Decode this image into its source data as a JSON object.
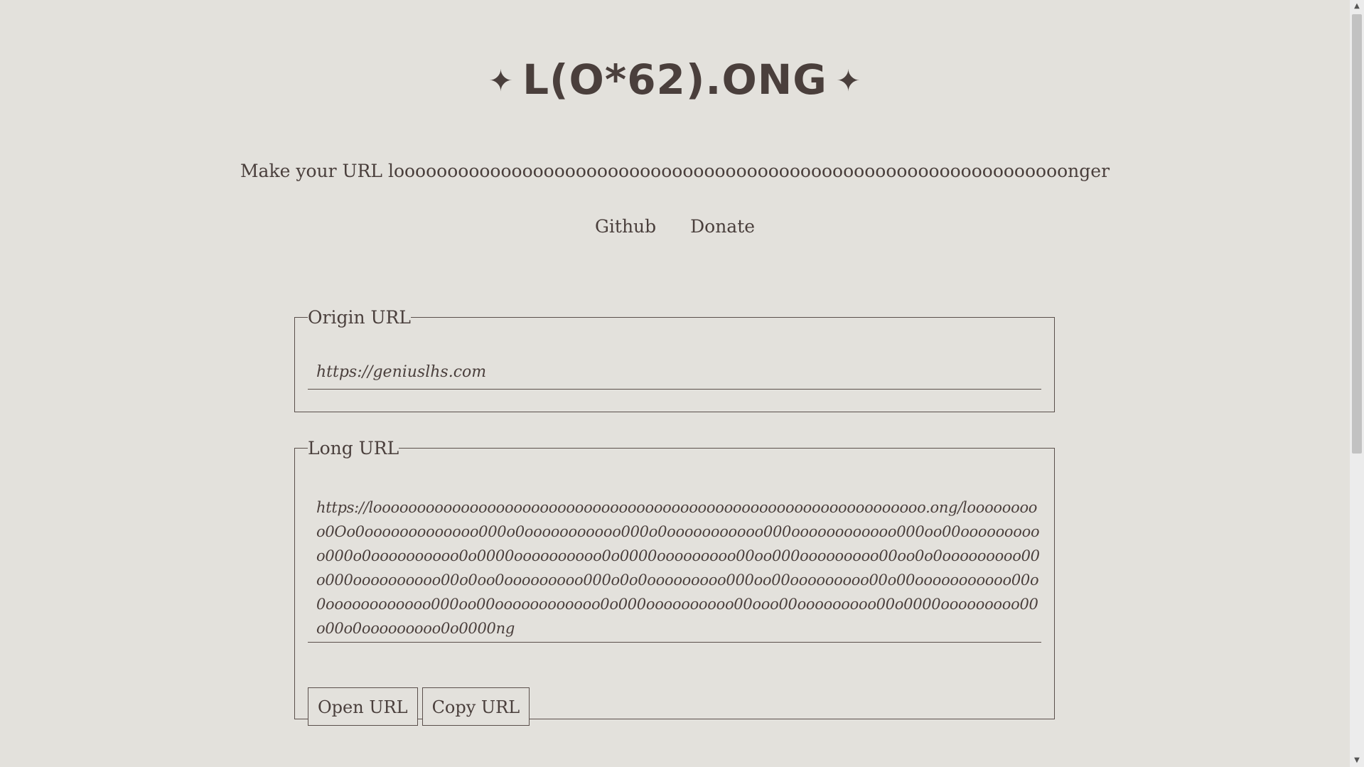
{
  "header": {
    "star_left": "✦",
    "title": "L(O*62).ONG",
    "star_right": "✦"
  },
  "tagline": "Make your URL looooooooooooooooooooooooooooooooooooooooooooooooooooooooooooooonger",
  "links": {
    "github": "Github",
    "donate": "Donate"
  },
  "origin": {
    "legend": "Origin URL",
    "value": "https://geniuslhs.com"
  },
  "long": {
    "legend": "Long URL",
    "value": "https://looooooooooooooooooooooooooooooooooooooooooooooooooooooooooooooo.ong/looooooooo0Oo0ooooooooooooo000o0ooooooooooo000o0ooooooooooo000oooooooooooo000oo00oooooooooo000o0oooooooooo0o0000oooooooooo0o0000ooooooooo00oo000ooooooooo00oo0o0ooooooooo00o000oooooooooo00o0oo0ooooooooo000o0o0ooooooooo000oo00ooooooooo00o00ooooooooooo00o0oooooooooooo000oo00oooooooooooo0o000oooooooooo00ooo00ooooooooo00o0000ooooooooo00o00o0ooooooooo0o0000ng",
    "open_label": "Open URL",
    "copy_label": "Copy URL"
  },
  "scrollbar": {
    "up": "▲",
    "down": "▼"
  }
}
